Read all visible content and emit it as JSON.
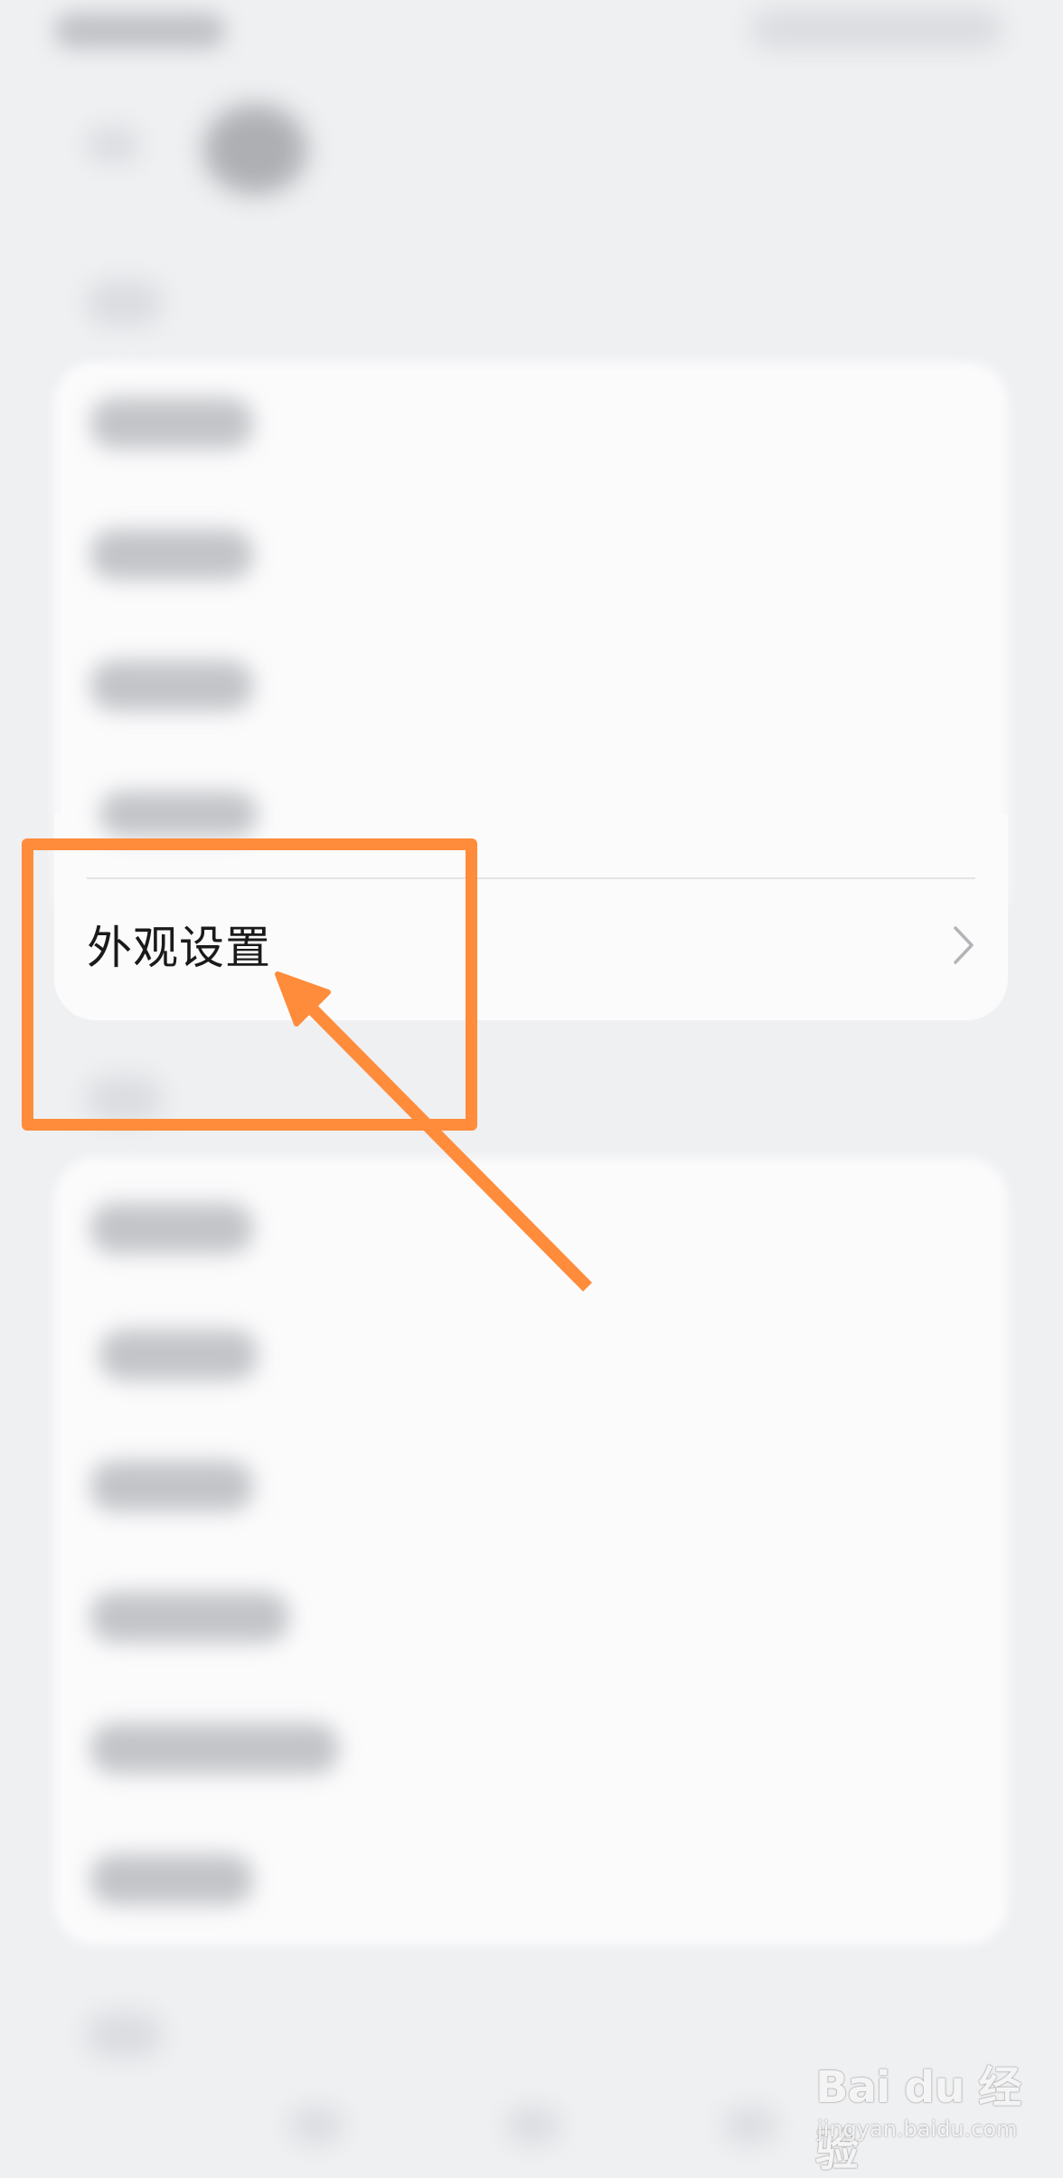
{
  "settings": {
    "appearance_item": {
      "label": "外观设置",
      "chevron_icon": "chevron-right-icon"
    }
  },
  "annotation": {
    "color": "#ff8c3b"
  },
  "watermark": {
    "brand": "Bai du 经验",
    "url": "jingyan.baidu.com"
  }
}
